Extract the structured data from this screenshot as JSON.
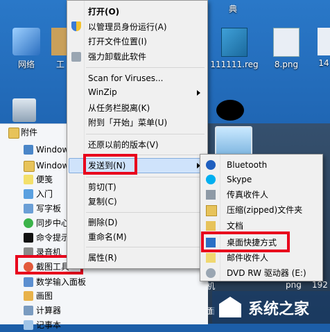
{
  "desktop": {
    "top_char": "典",
    "icons": [
      {
        "label": "网络"
      },
      {
        "label": "工"
      },
      {
        "label": "111111.reg"
      },
      {
        "label": "8.png"
      },
      {
        "label": "14"
      }
    ],
    "bottom_items": [
      "计算机",
      "控制面",
      "png",
      "192"
    ]
  },
  "start_menu": {
    "group_label": "附件",
    "items": [
      "Window",
      "Window",
      "便笺",
      "入门",
      "写字板",
      "同步中心",
      "命令提示",
      "录音机",
      "截图工具",
      "数学输入面板",
      "画图",
      "计算器",
      "记事本"
    ]
  },
  "context_menu": {
    "items": [
      {
        "label": "打开(O)",
        "bold": true
      },
      {
        "label": "以管理员身份运行(A)"
      },
      {
        "label": "打开文件位置(I)"
      },
      {
        "label": "强力卸载此软件"
      },
      {
        "label": "Scan for Viruses..."
      },
      {
        "label": "WinZip"
      },
      {
        "label": "从任务栏脱离(K)"
      },
      {
        "label": "附到「开始」菜单(U)"
      },
      {
        "label": "还原以前的版本(V)"
      },
      {
        "label": "发送到(N)"
      },
      {
        "label": "剪切(T)"
      },
      {
        "label": "复制(C)"
      },
      {
        "label": "删除(D)"
      },
      {
        "label": "重命名(M)"
      },
      {
        "label": "属性(R)"
      }
    ]
  },
  "sendto_menu": {
    "items": [
      "Bluetooth",
      "Skype",
      "传真收件人",
      "压缩(zipped)文件夹",
      "文档",
      "桌面快捷方式",
      "邮件收件人",
      "DVD RW 驱动器 (E:)"
    ]
  },
  "watermark": {
    "text": "系统之家"
  },
  "colors": {
    "highlight": "#e8001c",
    "menu_bg": "#f0f0f0",
    "hover": "#cfe3fb"
  }
}
